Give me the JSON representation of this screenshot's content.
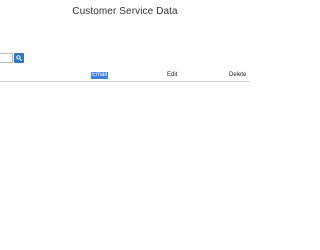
{
  "page": {
    "title": "Customer Service Data"
  },
  "search": {
    "value": "",
    "placeholder": "",
    "button_icon": "search-icon",
    "button_color": "#2f77c8"
  },
  "table": {
    "columns": [
      "Email",
      "Edit",
      "Delete"
    ],
    "selected_column": "Email",
    "selection_color": "#3b7fe0",
    "rows": []
  }
}
